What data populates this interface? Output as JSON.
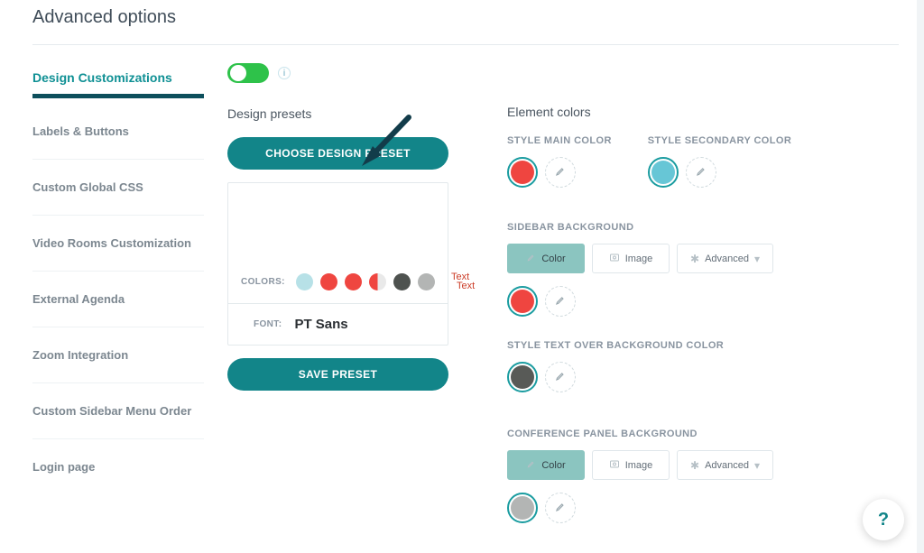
{
  "page": {
    "title": "Advanced options"
  },
  "sidebar": {
    "activeTab": "Design Customizations",
    "items": [
      {
        "label": "Labels & Buttons"
      },
      {
        "label": "Custom Global CSS"
      },
      {
        "label": "Video Rooms Customization"
      },
      {
        "label": "External Agenda"
      },
      {
        "label": "Zoom Integration"
      },
      {
        "label": "Custom Sidebar Menu Order"
      },
      {
        "label": "Login page"
      }
    ]
  },
  "annotation": {
    "text1": "Text",
    "text2": "Text"
  },
  "presets": {
    "title": "Design presets",
    "chooseBtn": "CHOOSE DESIGN PRESET",
    "colorsLabel": "COLORS:",
    "colors": [
      "#b7e1e7",
      "#ef4640",
      "#ef4640",
      "#efb9b5",
      "#4e524f",
      "#b3b5b4"
    ],
    "fontLabel": "FONT:",
    "fontValue": "PT Sans",
    "saveBtn": "SAVE PRESET"
  },
  "elements": {
    "title": "Element colors",
    "mainLabel": "STYLE MAIN COLOR",
    "secondaryLabel": "STYLE SECONDARY COLOR",
    "mainColor": "#ef4540",
    "secondaryColor": "#67c6d6",
    "sidebarBg": {
      "label": "SIDEBAR BACKGROUND",
      "tabs": {
        "color": "Color",
        "image": "Image",
        "advanced": "Advanced"
      },
      "color": "#ef4540"
    },
    "textOverBg": {
      "label": "STYLE TEXT OVER BACKGROUND COLOR",
      "color": "#585a57"
    },
    "confPanel": {
      "label": "CONFERENCE PANEL BACKGROUND",
      "tabs": {
        "color": "Color",
        "image": "Image",
        "advanced": "Advanced"
      },
      "color": "#b3b5b4"
    }
  },
  "help": "?"
}
